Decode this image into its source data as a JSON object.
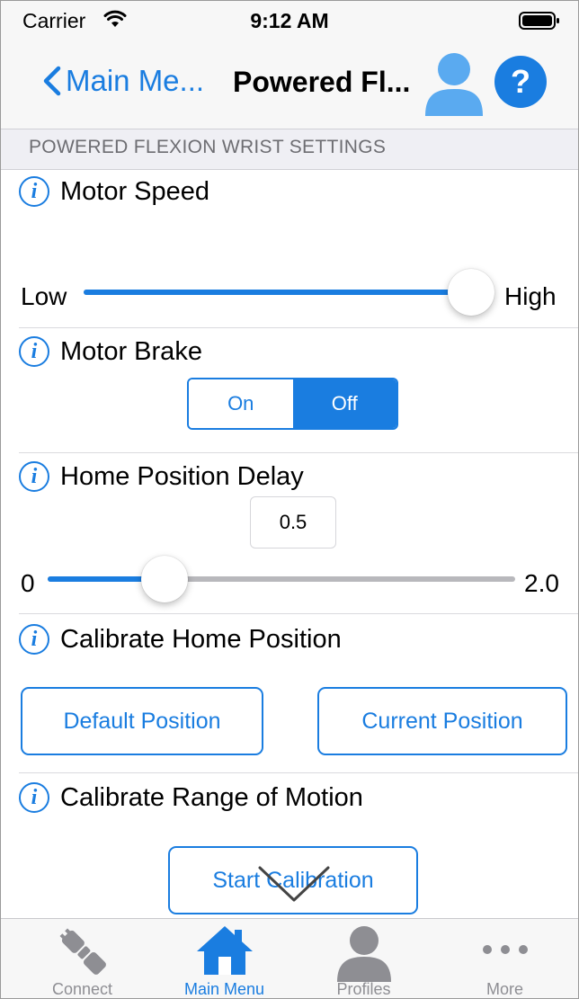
{
  "status_bar": {
    "carrier": "Carrier",
    "time": "9:12 AM"
  },
  "nav": {
    "back_label": "Main Me...",
    "title": "Powered Fl..."
  },
  "section_header": "POWERED FLEXION WRIST SETTINGS",
  "motor_speed": {
    "label": "Motor Speed",
    "min_label": "Low",
    "max_label": "High",
    "level": 1.0
  },
  "motor_brake": {
    "label": "Motor Brake",
    "options": [
      "On",
      "Off"
    ],
    "selected": "Off"
  },
  "home_position_delay": {
    "label": "Home Position Delay",
    "value": "0.5",
    "min_label": "0",
    "max_label": "2.0",
    "min": 0,
    "max": 2.0,
    "current": 0.5
  },
  "calibrate_home": {
    "label": "Calibrate Home Position",
    "default_button": "Default Position",
    "current_button": "Current Position"
  },
  "calibrate_range": {
    "label": "Calibrate Range of Motion",
    "start_button": "Start Calibration"
  },
  "tab_bar": {
    "items": [
      {
        "label": "Connect",
        "icon": "connect-icon"
      },
      {
        "label": "Main Menu",
        "icon": "home-icon"
      },
      {
        "label": "Profiles",
        "icon": "person-icon"
      },
      {
        "label": "More",
        "icon": "more-icon"
      }
    ],
    "active": "Main Menu"
  },
  "colors": {
    "accent": "#1a7de0",
    "track": "#b8b8bc",
    "bar_bg": "#f7f7f7",
    "section_bg": "#efeff4",
    "inactive": "#8e8e93"
  }
}
